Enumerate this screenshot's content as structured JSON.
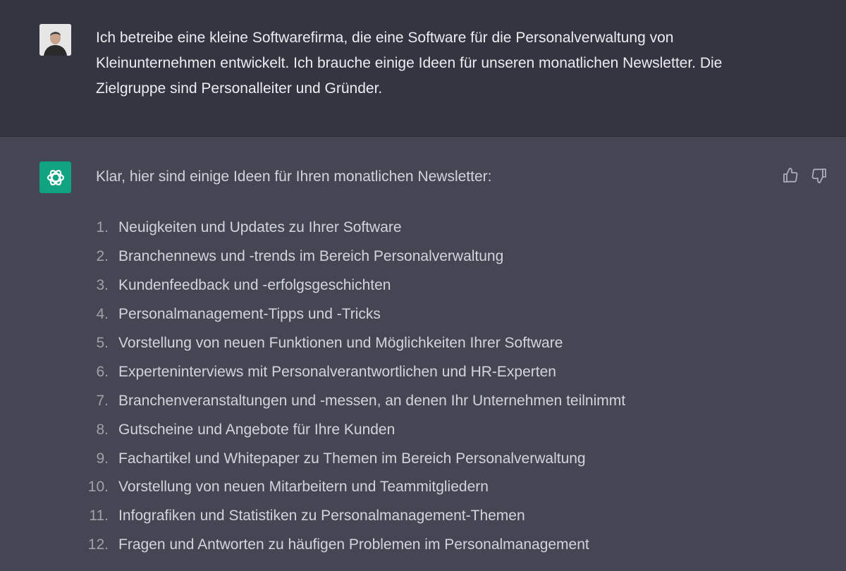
{
  "user_message": {
    "avatar": "user-photo",
    "text": "Ich betreibe eine kleine Softwarefirma, die eine Software für die Personalverwaltung von Kleinunternehmen entwickelt. Ich brauche einige Ideen für unseren monatlichen Newsletter. Die Zielgruppe sind Personalleiter und Gründer."
  },
  "assistant_message": {
    "avatar": "openai-logo-icon",
    "accent_color": "#10a37f",
    "intro": "Klar, hier sind einige Ideen für Ihren monatlichen Newsletter:",
    "items": [
      {
        "num": "1.",
        "text": "Neuigkeiten und Updates zu Ihrer Software"
      },
      {
        "num": "2.",
        "text": "Branchennews und -trends im Bereich Personalverwaltung"
      },
      {
        "num": "3.",
        "text": "Kundenfeedback und -erfolgsgeschichten"
      },
      {
        "num": "4.",
        "text": "Personalmanagement-Tipps und -Tricks"
      },
      {
        "num": "5.",
        "text": "Vorstellung von neuen Funktionen und Möglichkeiten Ihrer Software"
      },
      {
        "num": "6.",
        "text": "Experteninterviews mit Personalverantwortlichen und HR-Experten"
      },
      {
        "num": "7.",
        "text": "Branchenveranstaltungen und -messen, an denen Ihr Unternehmen teilnimmt"
      },
      {
        "num": "8.",
        "text": "Gutscheine und Angebote für Ihre Kunden"
      },
      {
        "num": "9.",
        "text": "Fachartikel und Whitepaper zu Themen im Bereich Personalverwaltung"
      },
      {
        "num": "10.",
        "text": "Vorstellung von neuen Mitarbeitern und Teammitgliedern"
      },
      {
        "num": "11.",
        "text": "Infografiken und Statistiken zu Personalmanagement-Themen"
      },
      {
        "num": "12.",
        "text": "Fragen und Antworten zu häufigen Problemen im Personalmanagement"
      }
    ],
    "feedback_icons": [
      "thumbs-up-icon",
      "thumbs-down-icon"
    ]
  },
  "colors": {
    "user_bg": "#343541",
    "assistant_bg": "#444654"
  }
}
